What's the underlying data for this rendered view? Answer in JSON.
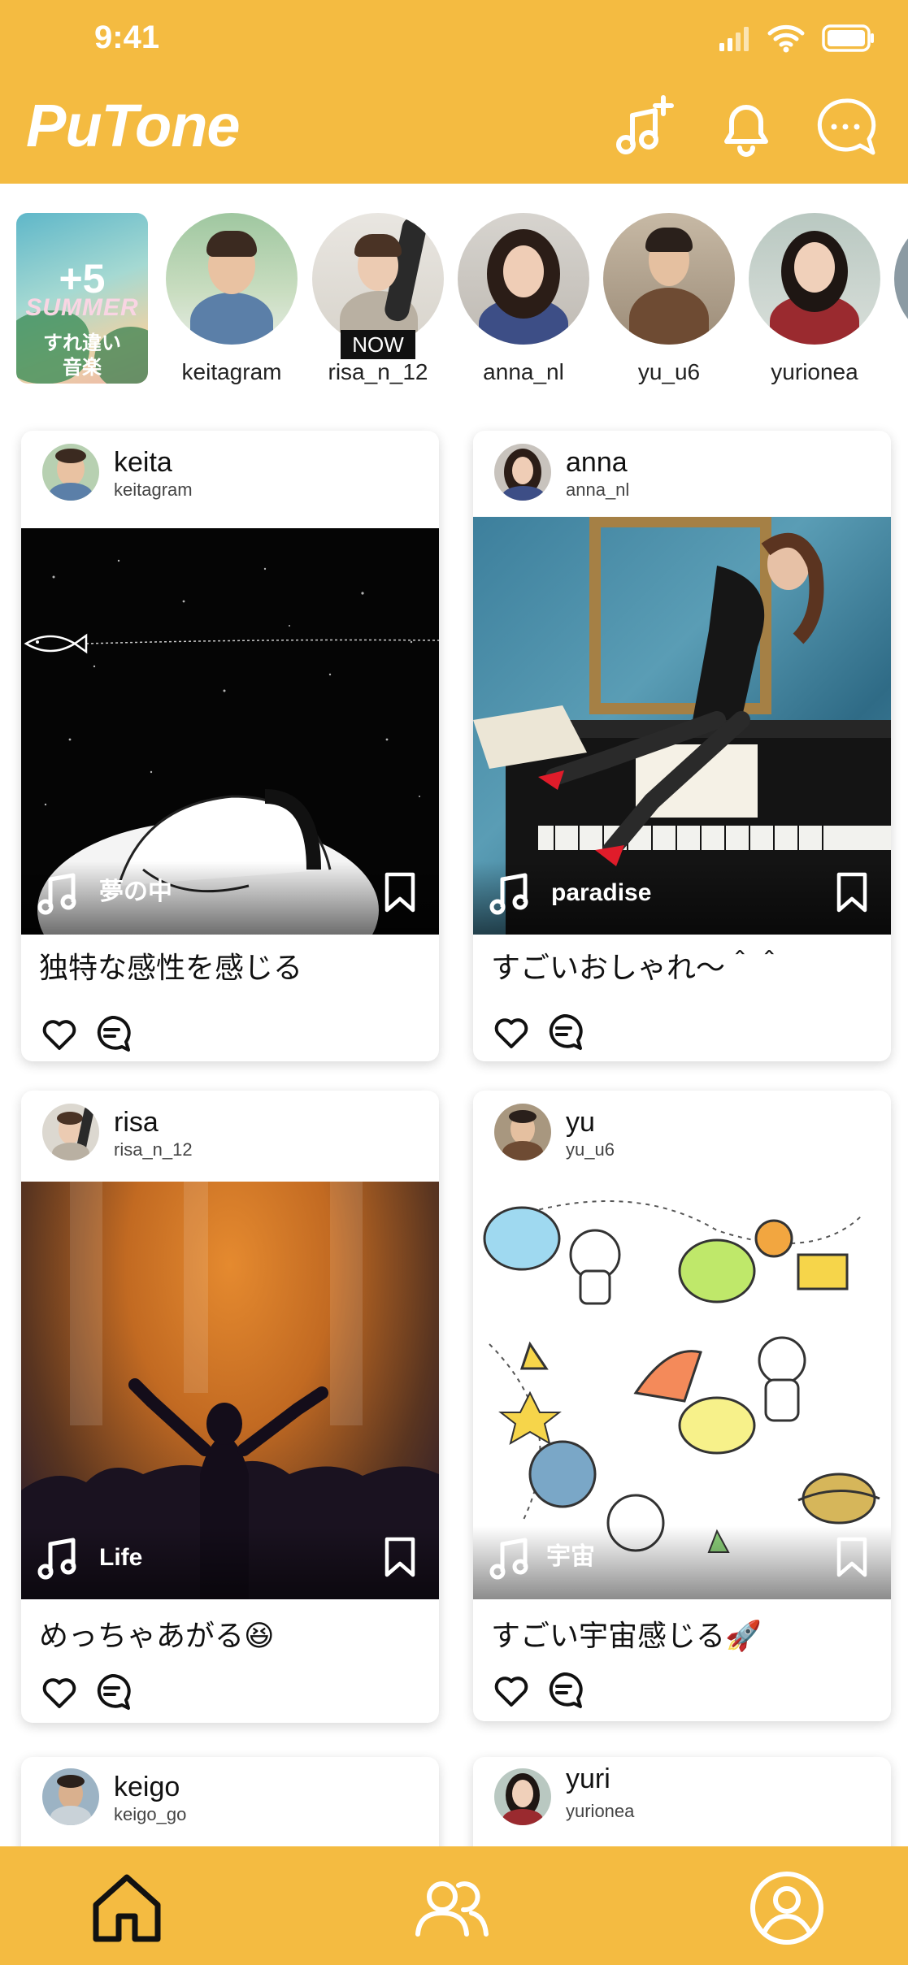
{
  "status_bar": {
    "time": "9:41"
  },
  "app": {
    "name": "PuTone"
  },
  "colors": {
    "brand": "#f4bb41",
    "text": "#111111"
  },
  "header_icons": [
    "music-add-icon",
    "bell-icon",
    "chat-icon"
  ],
  "stories": {
    "summer": {
      "count": "+5",
      "title": "SUMMER",
      "line1": "すれ違い",
      "line2": "音楽"
    },
    "items": [
      {
        "name": "keitagram",
        "badge": ""
      },
      {
        "name": "risa_n_12",
        "badge": "NOW"
      },
      {
        "name": "anna_nl",
        "badge": ""
      },
      {
        "name": "yu_u6",
        "badge": ""
      },
      {
        "name": "yurionea",
        "badge": ""
      }
    ]
  },
  "posts": [
    {
      "name": "keita",
      "handle": "keitagram",
      "song": "夢の中",
      "caption": "独特な感性を感じる"
    },
    {
      "name": "anna",
      "handle": "anna_nl",
      "song": "paradise",
      "caption": "すごいおしゃれ〜＾＾"
    },
    {
      "name": "risa",
      "handle": "risa_n_12",
      "song": "Life",
      "caption": "めっちゃあがる😆"
    },
    {
      "name": "yu",
      "handle": "yu_u6",
      "song": "宇宙",
      "caption": "すごい宇宙感じる🚀"
    },
    {
      "name": "keigo",
      "handle": "keigo_go",
      "song": "",
      "caption": ""
    },
    {
      "name": "yuri",
      "handle": "yurionea",
      "song": "",
      "caption": ""
    }
  ],
  "bottom_nav": [
    "home-icon",
    "friends-icon",
    "profile-icon"
  ]
}
